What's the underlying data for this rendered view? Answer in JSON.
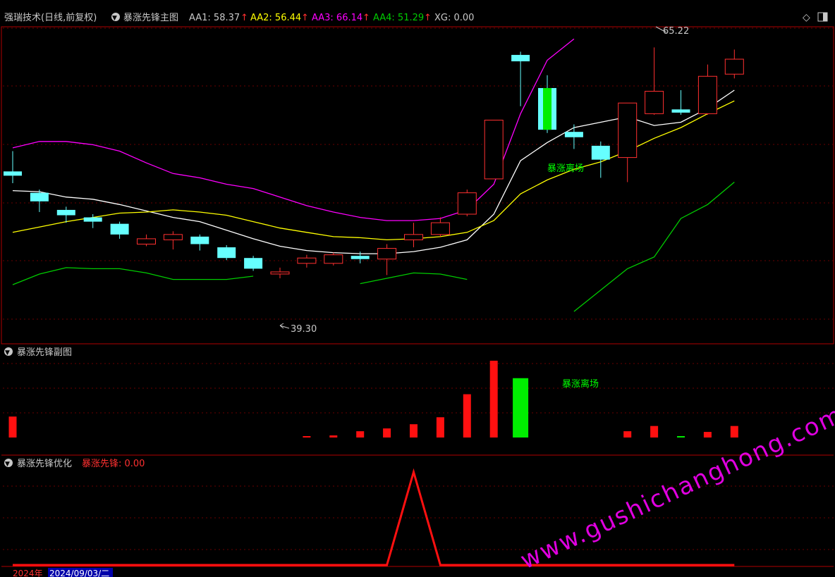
{
  "main_panel": {
    "title": "强瑞技术(日线,前复权)",
    "indicator": "暴涨先锋主图",
    "aa1_label": "AA1: 58.37",
    "aa2_label": "AA2: 56.44",
    "aa3_label": "AA3: 66.14",
    "aa4_label": "AA4: 51.29",
    "xg_label": "XG: 0.00",
    "aa1_color": "#ffffff",
    "aa2_color": "#ffff00",
    "aa3_color": "#ff00ff",
    "aa4_color": "#00cc00",
    "arrow_color": "#ff3030",
    "high_annotation": "65.22",
    "low_annotation": "39.30",
    "signal_text": "暴涨离场"
  },
  "sub_panel": {
    "title": "暴涨先锋副图",
    "signal_text": "暴涨离场"
  },
  "opt_panel": {
    "title": "暴涨先锋优化",
    "value_label": "暴涨先锋: 0.00"
  },
  "footer": {
    "year": "2024年",
    "date": "2024/09/03/二"
  },
  "watermark": "www.gushichanghong.com",
  "chart_data": [
    {
      "type": "candlestick",
      "title": "暴涨先锋主图",
      "ylim": [
        38,
        67
      ],
      "candles": [
        {
          "o": 53.6,
          "c": 53.2,
          "h": 55.5,
          "l": 52.5
        },
        {
          "o": 51.6,
          "c": 50.8,
          "h": 51.9,
          "l": 49.8
        },
        {
          "o": 50.0,
          "c": 49.5,
          "h": 50.3,
          "l": 48.8
        },
        {
          "o": 49.3,
          "c": 48.9,
          "h": 49.6,
          "l": 48.3
        },
        {
          "o": 48.7,
          "c": 47.7,
          "h": 48.9,
          "l": 47.3
        },
        {
          "o": 46.8,
          "c": 47.3,
          "h": 47.7,
          "l": 46.6
        },
        {
          "o": 47.2,
          "c": 47.7,
          "h": 48.0,
          "l": 46.3
        },
        {
          "o": 47.5,
          "c": 46.8,
          "h": 47.7,
          "l": 46.2
        },
        {
          "o": 46.5,
          "c": 45.5,
          "h": 46.7,
          "l": 45.3
        },
        {
          "o": 45.5,
          "c": 44.5,
          "h": 45.7,
          "l": 44.3
        },
        {
          "o": 44.0,
          "c": 44.2,
          "h": 44.6,
          "l": 43.6
        },
        {
          "o": 45.0,
          "c": 45.5,
          "h": 45.8,
          "l": 44.6
        },
        {
          "o": 45.0,
          "c": 45.8,
          "h": 46.0,
          "l": 44.8
        },
        {
          "o": 45.7,
          "c": 45.4,
          "h": 46.1,
          "l": 45.0
        },
        {
          "o": 45.4,
          "c": 46.4,
          "h": 46.8,
          "l": 43.9
        },
        {
          "o": 47.2,
          "c": 47.7,
          "h": 48.8,
          "l": 46.5
        },
        {
          "o": 47.7,
          "c": 48.8,
          "h": 49.3,
          "l": 47.5
        },
        {
          "o": 49.6,
          "c": 51.6,
          "h": 51.9,
          "l": 49.4
        },
        {
          "o": 52.9,
          "c": 58.4,
          "h": 58.4,
          "l": 52.9
        },
        {
          "o": 64.5,
          "c": 63.9,
          "h": 64.8,
          "l": 59.7
        },
        {
          "o": 61.4,
          "c": 57.5,
          "h": 62.6,
          "l": 57.2
        },
        {
          "o": 57.3,
          "c": 56.8,
          "h": 58.0,
          "l": 55.7
        },
        {
          "o": 56.0,
          "c": 54.7,
          "h": 56.4,
          "l": 53.0
        },
        {
          "o": 54.9,
          "c": 60.0,
          "h": 60.0,
          "l": 52.6
        },
        {
          "o": 59.0,
          "c": 61.1,
          "h": 65.2,
          "l": 58.9
        },
        {
          "o": 59.4,
          "c": 59.1,
          "h": 61.2,
          "l": 58.9
        },
        {
          "o": 59.0,
          "c": 62.5,
          "h": 63.6,
          "l": 58.9
        },
        {
          "o": 62.7,
          "c": 64.1,
          "h": 65.0,
          "l": 62.3
        }
      ],
      "series": [
        {
          "name": "AA1",
          "values": [
            51.8,
            51.7,
            51.2,
            51.0,
            50.5,
            49.9,
            49.3,
            48.9,
            48.1,
            47.3,
            46.6,
            46.2,
            46.0,
            45.9,
            45.9,
            46.1,
            46.5,
            47.2,
            49.6,
            54.6,
            56.3,
            57.7,
            58.2,
            58.7,
            57.9,
            58.2,
            59.5,
            61.2
          ]
        },
        {
          "name": "AA2",
          "values": [
            47.9,
            48.4,
            48.9,
            49.3,
            49.7,
            49.8,
            50.0,
            49.8,
            49.5,
            48.9,
            48.3,
            47.9,
            47.5,
            47.4,
            47.2,
            47.3,
            47.5,
            47.9,
            49.0,
            51.5,
            52.8,
            53.8,
            54.5,
            55.5,
            56.7,
            57.7,
            59.0,
            60.2
          ]
        },
        {
          "name": "AA3",
          "values": [
            55.8,
            56.4,
            56.4,
            56.1,
            55.5,
            54.4,
            53.4,
            53.0,
            52.4,
            52.0,
            51.2,
            50.4,
            49.8,
            49.3,
            49.0,
            49.0,
            49.2,
            50.0,
            52.4,
            59.0,
            64.0,
            66.0
          ]
        },
        {
          "name": "AA4",
          "values": [
            43.0,
            44.0,
            44.6,
            44.5,
            44.5,
            44.1,
            43.5,
            43.5,
            43.5,
            43.8,
            null,
            null,
            null,
            43.1,
            43.6,
            44.1,
            44.0,
            43.5,
            null,
            null,
            null,
            40.5,
            42.5,
            44.5,
            45.6,
            49.2,
            50.5,
            52.6
          ]
        }
      ],
      "signal": {
        "index": 20,
        "label": "暴涨离场"
      }
    },
    {
      "type": "bar",
      "title": "暴涨先锋副图",
      "ylim": [
        0,
        22
      ],
      "values": [
        6,
        0,
        0,
        0,
        0,
        0,
        0,
        0,
        0,
        0,
        0,
        0.4,
        0.6,
        1.8,
        2.6,
        3.8,
        5.8,
        12.4,
        22,
        17,
        0,
        0,
        0,
        1.8,
        3.3,
        0.4,
        1.6,
        3.3
      ],
      "colors": [
        "red",
        "red",
        "red",
        "red",
        "red",
        "red",
        "red",
        "red",
        "red",
        "red",
        "red",
        "red",
        "red",
        "red",
        "red",
        "red",
        "red",
        "red",
        "red",
        "green",
        "red",
        "red",
        "red",
        "red",
        "red",
        "green",
        "red",
        "red"
      ],
      "annotation": "暴涨离场"
    },
    {
      "type": "line",
      "title": "暴涨先锋优化",
      "ylim": [
        0,
        1
      ],
      "values": [
        0,
        0,
        0,
        0,
        0,
        0,
        0,
        0,
        0,
        0,
        0,
        0,
        0,
        0,
        0,
        1,
        0,
        0,
        0,
        0,
        0,
        0,
        0,
        0,
        0,
        0,
        0,
        0
      ]
    }
  ]
}
